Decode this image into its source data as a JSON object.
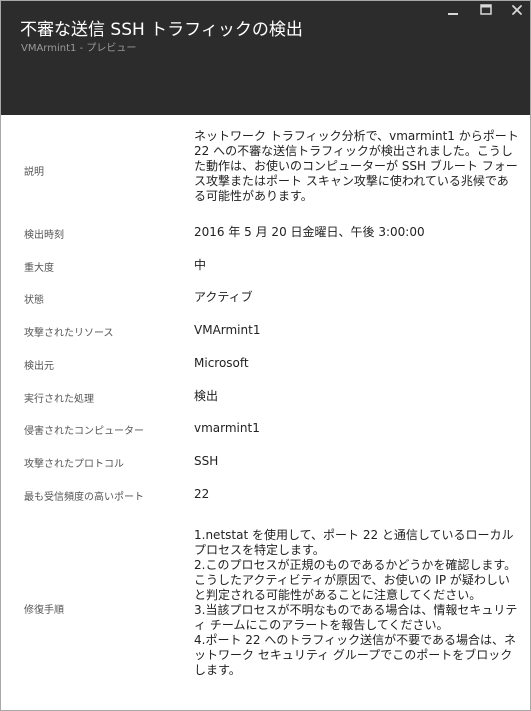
{
  "window": {
    "title": "不審な送信 SSH トラフィックの検出",
    "subtitle": "VMArmint1 - プレビュー",
    "controls": {
      "minimize_icon": "minimize-icon",
      "maximize_icon": "maximize-icon",
      "close_icon": "close-icon"
    },
    "colors": {
      "header_bg": "#2c2c2c",
      "title": "#ffffff",
      "subtitle": "#9a9a9a"
    }
  },
  "details": [
    {
      "label": "説明",
      "value": "ネットワーク トラフィック分析で、vmarmint1 からポート 22 への不審な送信トラフィックが検出されました。こうした動作は、お使いのコンピューターが SSH ブルート フォース攻撃またはポート スキャン攻撃に使われている兆候である可能性があります。"
    },
    {
      "label": "検出時刻",
      "value": "2016 年 5 月 20 日金曜日、午後 3:00:00"
    },
    {
      "label": "重大度",
      "value": "中"
    },
    {
      "label": "状態",
      "value": "アクティブ"
    },
    {
      "label": "攻撃されたリソース",
      "value": "VMArmint1"
    },
    {
      "label": "検出元",
      "value": "Microsoft"
    },
    {
      "label": "実行された処理",
      "value": "検出"
    },
    {
      "label": "侵害されたコンピューター",
      "value": "vmarmint1"
    },
    {
      "label": "攻撃されたプロトコル",
      "value": "SSH"
    },
    {
      "label": "最も受信頻度の高いポート",
      "value": "22"
    },
    {
      "label": "修復手順",
      "value": "1.netstat を使用して、ポート 22 と通信しているローカル プロセスを特定します。\n2.このプロセスが正規のものであるかどうかを確認します。こうしたアクティビティが原因で、お使いの IP が疑わしいと判定される可能性があることに注意してください。\n3.当該プロセスが不明なものである場合は、情報セキュリティ チームにこのアラートを報告してください。\n4.ポート 22 へのトラフィック送信が不要である場合は、ネットワーク セキュリティ グループでこのポートをブロックします。"
    }
  ]
}
